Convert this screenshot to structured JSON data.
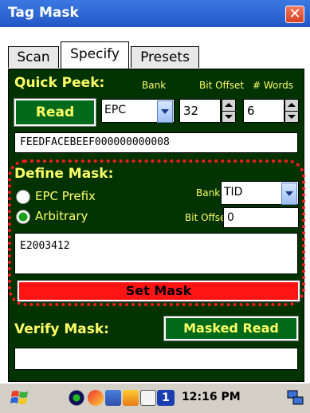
{
  "window": {
    "title": "Tag Mask",
    "close_glyph": "✕"
  },
  "tabs": [
    {
      "label": "Scan",
      "active": false
    },
    {
      "label": "Specify",
      "active": true
    },
    {
      "label": "Presets",
      "active": false
    }
  ],
  "quick_peek": {
    "title": "Quick Peek:",
    "bank_label": "Bank",
    "offset_label": "Bit Offset",
    "words_label": "# Words",
    "read_button": "Read",
    "bank_value": "EPC",
    "offset_value": "32",
    "words_value": "6",
    "readout": "FEEDFACEBEEF000000000008"
  },
  "define_mask": {
    "title": "Define Mask:",
    "option_epc_prefix": "EPC Prefix",
    "option_arbitrary": "Arbitrary",
    "selected_option": "Arbitrary",
    "bank_label": "Bank",
    "bank_value": "TID",
    "offset_label": "Bit Offset",
    "offset_value": "0",
    "mask_value": "E2003412",
    "set_mask_button": "Set Mask"
  },
  "verify_mask": {
    "title": "Verify Mask:",
    "masked_read_button": "Masked Read",
    "output": ""
  },
  "taskbar": {
    "clock": "12:16 PM",
    "tray_badge": "1"
  },
  "colors": {
    "panel_bg": "#003300",
    "label_yellow": "#ffff66",
    "button_green": "#006a1a",
    "button_red": "#ff1414",
    "highlight_dotted": "#ff1a1a",
    "titlebar_blue": "#2257c5"
  },
  "icons": [
    "close-icon",
    "dropdown-arrow-icon",
    "spin-up-icon",
    "spin-down-icon",
    "windows-start-icon",
    "network-icon",
    "sync-icon",
    "connection-icon",
    "battery-icon",
    "keyboard-icon",
    "desktop-icon"
  ]
}
